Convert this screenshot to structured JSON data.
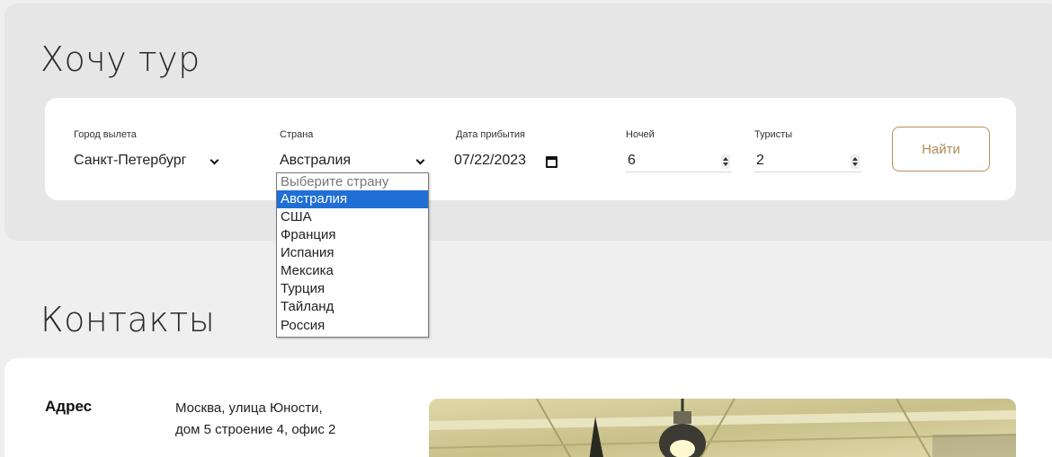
{
  "tour": {
    "title": "Хочу тур",
    "departure_city": {
      "label": "Город вылета",
      "value": "Санкт-Петербург"
    },
    "country": {
      "label": "Страна",
      "value": "Австралия",
      "options": [
        "Выберите страну",
        "Австралия",
        "США",
        "Франция",
        "Испания",
        "Мексика",
        "Турция",
        "Тайланд",
        "Россия"
      ],
      "selected_index": 1
    },
    "arrival_date": {
      "label": "Дата прибытия",
      "value": "07/22/2023"
    },
    "nights": {
      "label": "Ночей",
      "value": "6"
    },
    "tourists": {
      "label": "Туристы",
      "value": "2"
    },
    "search_button": "Найти"
  },
  "contacts": {
    "title": "Контакты",
    "address_label": "Адрес",
    "address_line1": "Москва, улица Юности,",
    "address_line2": "дом 5 строение 4, офис 2"
  },
  "colors": {
    "accent": "#b8905a",
    "selected_option": "#1f6fd6",
    "section_bg": "#e6e6e6",
    "page_bg": "#efefef"
  },
  "icons": [
    "chevron-down-icon",
    "calendar-icon",
    "spinner-icon"
  ]
}
